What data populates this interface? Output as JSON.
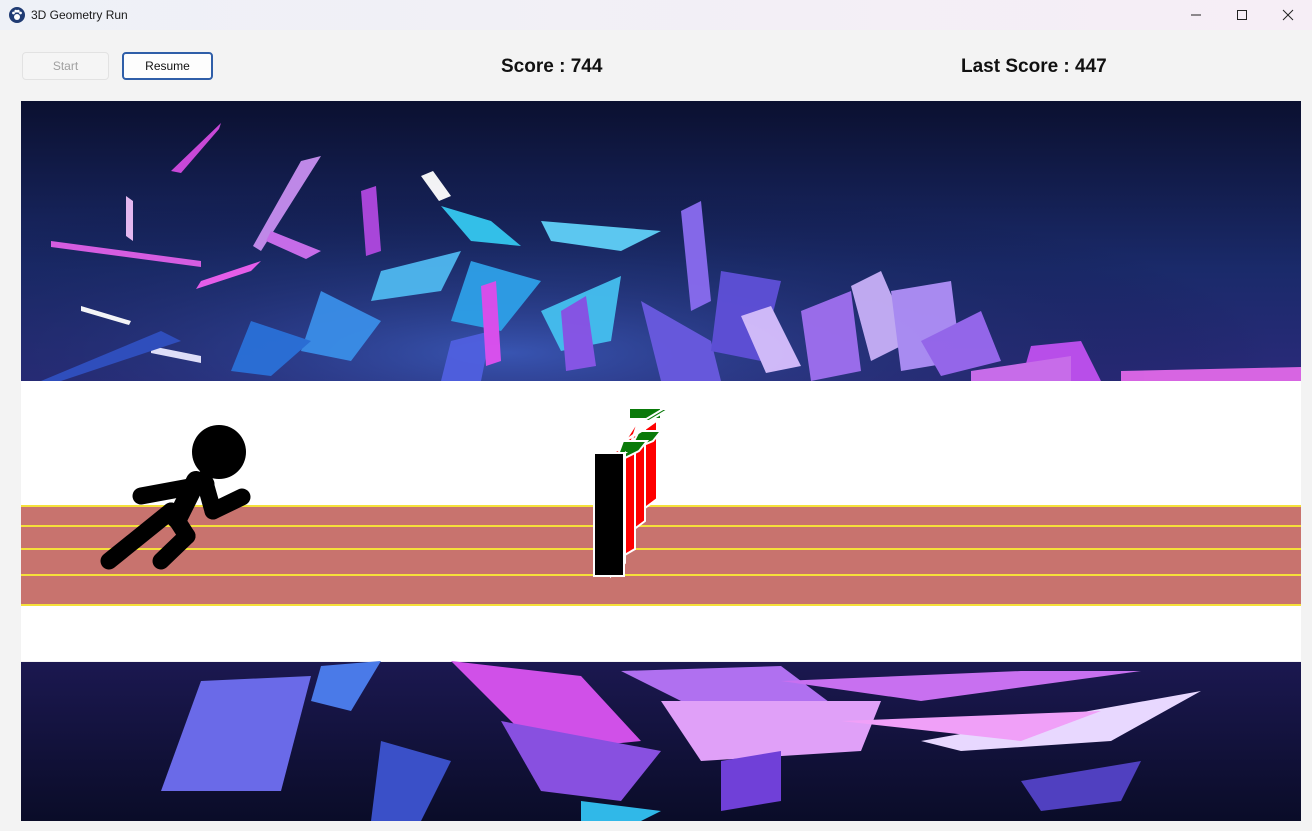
{
  "window": {
    "title": "3D Geometry Run",
    "app_icon": "paw-icon",
    "controls": [
      "minimize-icon",
      "maximize-icon",
      "close-icon"
    ]
  },
  "toolbar": {
    "start_label": "Start",
    "start_enabled": false,
    "resume_label": "Resume"
  },
  "hud": {
    "score_text": "Score : 744",
    "last_score_text": "Last Score : 447"
  },
  "colors": {
    "track": "#c8736e",
    "lane_line": "#f5e03a",
    "obstacle_front": "#000000",
    "obstacle_side": "#ff0000",
    "obstacle_top": "#0a7a0a",
    "sky_dark": "#0f1538",
    "accent_cyan": "#35c8f0",
    "accent_magenta": "#c04cf0"
  }
}
